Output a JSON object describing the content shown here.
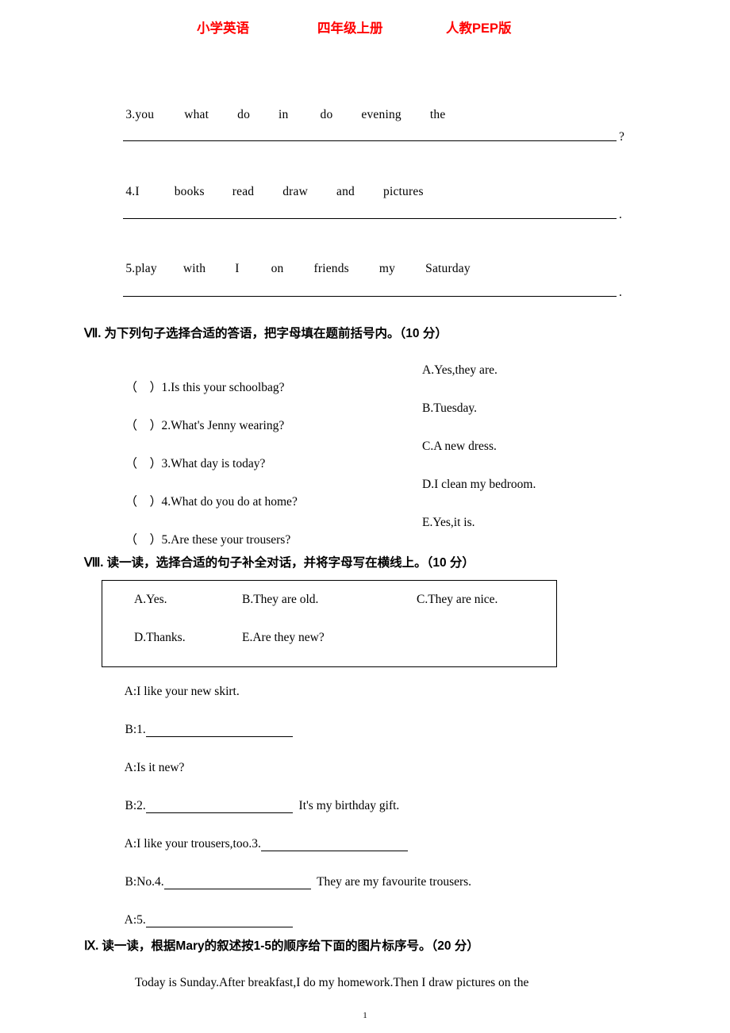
{
  "header": {
    "subject": "小学英语",
    "grade": "四年级上册",
    "edition": "人教PEP版"
  },
  "reorder": {
    "items": [
      {
        "number": "3.you",
        "words": [
          "what",
          "do",
          "in",
          "do",
          "evening",
          "the"
        ],
        "tail": "?"
      },
      {
        "number": "4.I",
        "words": [
          "books",
          "read",
          "draw",
          "and",
          "pictures"
        ],
        "tail": "."
      },
      {
        "number": "5.play",
        "words": [
          "with",
          "I",
          "on",
          "friends",
          "my",
          "Saturday"
        ],
        "tail": "."
      }
    ]
  },
  "section7": {
    "roman": "Ⅶ.",
    "title": "为下列句子选择合适的答语，把字母填在题前括号内。（10 分）",
    "rows": [
      {
        "paren": "（    ）",
        "left": "1.Is this your schoolbag?",
        "right": "A.Yes,they are."
      },
      {
        "paren": "（    ）",
        "left": "2.What's Jenny wearing?",
        "right": "B.Tuesday."
      },
      {
        "paren": "（    ）",
        "left": "3.What day is today?",
        "right": "C.A new dress."
      },
      {
        "paren": "（    ）",
        "left": "4.What do you do at home?",
        "right": "D.I clean my bedroom."
      },
      {
        "paren": "（    ）",
        "left": "5.Are these your trousers?",
        "right": "E.Yes,it is."
      }
    ]
  },
  "section8": {
    "roman": "Ⅷ.",
    "title": "读一读，选择合适的句子补全对话，并将字母写在横线上。（10 分）",
    "choices_row1": [
      "A.Yes.",
      "B.They are old.",
      "C.They are nice."
    ],
    "choices_row2": [
      "D.Thanks.",
      "E.Are they new?"
    ],
    "dialog": [
      {
        "speaker": "A:",
        "before": "I like your new skirt.",
        "rule": 0,
        "after": ""
      },
      {
        "speaker": "B:",
        "before": "1.",
        "rule": 185,
        "after": ""
      },
      {
        "speaker": "A:",
        "before": "Is it new?",
        "rule": 0,
        "after": ""
      },
      {
        "speaker": "B:",
        "before": "2.",
        "rule": 185,
        "after": "  It's my birthday gift."
      },
      {
        "speaker": "A:",
        "before": "I like your trousers,too.3.",
        "rule": 185,
        "after": ""
      },
      {
        "speaker": "B:",
        "before": "No.4.",
        "rule": 185,
        "after": "  They are my favourite trousers."
      },
      {
        "speaker": "A:",
        "before": "5.",
        "rule": 185,
        "after": ""
      }
    ]
  },
  "section9": {
    "roman": "Ⅸ.",
    "title": "读一读，根据Mary的叙述按1-5的顺序给下面的图片标序号。（20 分）",
    "paragraph": "Today is Sunday.After breakfast,I do my homework.Then I draw pictures on the"
  },
  "footer": {
    "page_number": "1"
  }
}
